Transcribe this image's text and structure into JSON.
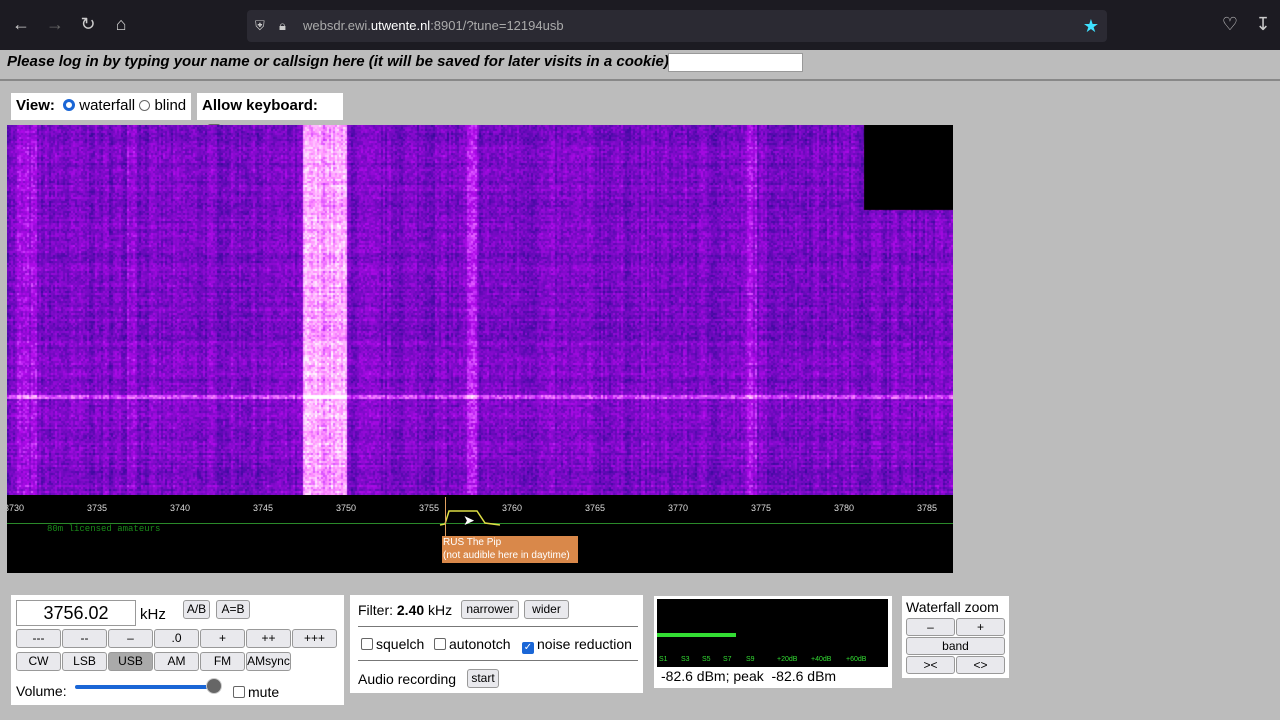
{
  "browser": {
    "url_host": "websdr.ewi.",
    "url_domain": "utwente.nl",
    "url_rest": ":8901/?tune=12194usb"
  },
  "login": {
    "prompt": "Please log in by typing your name or callsign here (it will be saved for later visits in a cookie):",
    "value": ""
  },
  "view": {
    "label": "View:",
    "waterfall": "waterfall",
    "blind": "blind",
    "selected": "waterfall",
    "keyboard_label": "Allow keyboard:",
    "keyboard_checked": false
  },
  "axis": {
    "ticks": [
      "3730",
      "3735",
      "3740",
      "3745",
      "3750",
      "3755",
      "3760",
      "3765",
      "3770",
      "3775",
      "3780",
      "3785"
    ],
    "band_label": "80m licensed amateurs",
    "station_name": "RUS The Pip",
    "station_note": "(not audible here in daytime)",
    "tuned_khz": 3756.02
  },
  "tuning": {
    "frequency": "3756.02",
    "unit": "kHz",
    "ab": "A/B",
    "aeqb": "A=B",
    "steps": [
      "---",
      "--",
      "–",
      ".0",
      "+",
      "++",
      "+++"
    ],
    "modes": [
      "CW",
      "LSB",
      "USB",
      "AM",
      "FM",
      "AMsync"
    ],
    "active_mode": "USB",
    "volume_label": "Volume:",
    "volume_level": 0.97,
    "mute": "mute"
  },
  "filter": {
    "label": "Filter:",
    "value": "2.40",
    "unit": "kHz",
    "narrower": "narrower",
    "wider": "wider",
    "squelch": "squelch",
    "autonotch": "autonotch",
    "noise_reduction": "noise reduction",
    "nr_checked": true,
    "recording_label": "Audio recording",
    "start": "start"
  },
  "smeter": {
    "scale": [
      "S1",
      "S3",
      "S5",
      "S7",
      "S9",
      "+20dB",
      "+40dB",
      "+60dB"
    ],
    "readout": "-82.6 dBm; peak  -82.6 dBm",
    "color": "#33dd33"
  },
  "zoom": {
    "title": "Waterfall zoom",
    "minus": "–",
    "plus": "+",
    "band": "band",
    "narrow": "><",
    "wide": "<>"
  }
}
